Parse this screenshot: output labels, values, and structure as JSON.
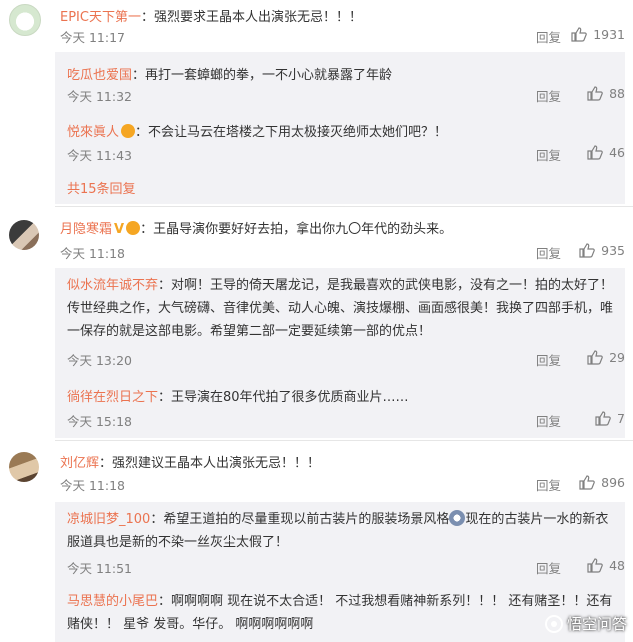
{
  "common": {
    "reply_label": "回复",
    "reply_count_label": "共15条回复"
  },
  "comments": [
    {
      "user": "EPIC天下第一",
      "text": "：强烈要求王晶本人出演张无忌！！！",
      "time": "今天 11:17",
      "likes": "1931",
      "replies": [
        {
          "user": "吃瓜也爱国",
          "text": "：再打一套蟑螂的拳，一不小心就暴露了年龄",
          "time": "今天 11:32",
          "likes": "88"
        },
        {
          "user": "悦來眞人",
          "text": "：不会让马云在塔楼之下用太极接灭绝师太她们吧？！",
          "time": "今天 11:43",
          "likes": "46"
        }
      ]
    },
    {
      "user": "月隐寒霜",
      "text": "：王晶导演你要好好去拍，拿出你九〇年代的劲头来。",
      "time": "今天 11:18",
      "likes": "935",
      "replies": [
        {
          "user": "似水流年诚不弃",
          "text": "：对啊！王导的倚天屠龙记，是我最喜欢的武侠电影，没有之一！拍的太好了！传世经典之作，大气磅礴、音律优美、动人心魄、演技爆棚、画面感很美！我换了四部手机，唯一保存的就是这部电影。希望第二部一定要延续第一部的优点！",
          "time": "今天 13:20",
          "likes": "29"
        },
        {
          "user": "徜徉在烈日之下",
          "text": "：王导演在80年代拍了很多优质商业片……",
          "time": "今天 15:18",
          "likes": "7"
        }
      ]
    },
    {
      "user": "刘亿辉",
      "text": "：强烈建议王晶本人出演张无忌！！！",
      "time": "今天 11:18",
      "likes": "896",
      "replies": [
        {
          "user": "凉城旧梦_100",
          "text_a": "：希望王道拍的尽量重现以前古装片的服装场景风格",
          "text_b": "现在的古装片一水的新衣服道具也是新的不染一丝灰尘太假了！",
          "time": "今天 11:51",
          "likes": "48"
        },
        {
          "user": "马思慧的小尾巴",
          "text": "：啊啊啊啊 现在说不太合适！ 不过我想看赌神新系列！！！ 还有赌圣！！还有赌侠！！ 星爷 发哥。华仔。 啊啊啊啊啊啊"
        }
      ]
    }
  ],
  "watermark": "悟空问答"
}
